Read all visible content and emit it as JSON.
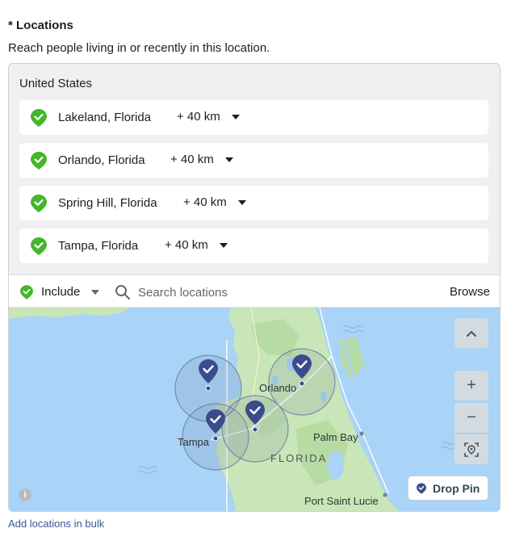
{
  "section": {
    "heading": "* Locations",
    "subtext": "Reach people living in or recently in this location."
  },
  "panel": {
    "country": "United States",
    "locations": [
      {
        "name": "Lakeland, Florida",
        "radius": "+ 40 km"
      },
      {
        "name": "Orlando, Florida",
        "radius": "+ 40 km"
      },
      {
        "name": "Spring Hill, Florida",
        "radius": "+ 40 km"
      },
      {
        "name": "Tampa, Florida",
        "radius": "+ 40 km"
      }
    ],
    "include_label": "Include",
    "search_placeholder": "Search locations",
    "browse_label": "Browse"
  },
  "map": {
    "labels": {
      "orlando": "Orlando",
      "tampa": "Tampa",
      "palm_bay": "Palm Bay",
      "florida": "FLORIDA",
      "port_saint_lucie": "Port Saint Lucie"
    },
    "controls": {
      "collapse_icon": "chevron-up-icon",
      "zoom_in": "+",
      "zoom_out": "−",
      "locate_icon": "locate-icon"
    },
    "drop_pin_label": "Drop Pin",
    "info_icon": "i"
  },
  "footer": {
    "bulk_link": "Add locations in bulk"
  },
  "colors": {
    "pin_green": "#42b72a",
    "map_pin_blue": "#3b4c8c",
    "water": "#a9d3f7",
    "land": "#c8e6b8",
    "link": "#385898"
  }
}
